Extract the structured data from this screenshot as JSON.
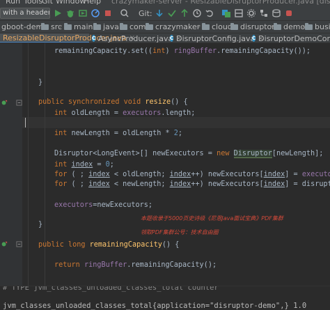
{
  "menubar": {
    "items": [
      "Run",
      "Tools",
      "Git",
      "Window",
      "Help"
    ],
    "title": "crazymaker-server - ResizableDisruptorProducer.java [disruptor-springboot-demo]"
  },
  "toolbar": {
    "run_config": "with a header#3",
    "git_label": "Git:"
  },
  "breadcrumb": [
    "gboot-demo",
    "src",
    "main",
    "java",
    "com",
    "crazymaker",
    "cloud",
    "disruptor",
    "demo",
    "business",
    "impl",
    "ResizableDisr"
  ],
  "tabs": [
    {
      "label": "ResizableDisruptorProducer.java",
      "active": true
    },
    {
      "label": "AsyncProducer.java",
      "active": false
    },
    {
      "label": "DisruptorConfig.java",
      "active": false
    },
    {
      "label": "DisruptorDemoControlle",
      "active": false
    }
  ],
  "code": {
    "l1": {
      "a": "remainingCapacity.set((",
      "b": "int",
      "c": ") ",
      "d": "ringBuffer",
      "e": ".remainingCapacity());"
    },
    "l2": "}",
    "l3": {
      "a": "public synchronized void ",
      "b": "resize",
      "c": "() {"
    },
    "l4": {
      "a": "int ",
      "b": "oldLength = ",
      "c": "executors",
      "d": ".length;"
    },
    "l5": {
      "a": "int ",
      "b": "newLength = oldLength * ",
      "c": "2",
      "d": ";"
    },
    "l6": {
      "a": "Disruptor<LongEvent>[] newExecutors = ",
      "b": "new ",
      "c": "Disruptor",
      "d": "[newLength];"
    },
    "l7": {
      "a": "int ",
      "b": "index",
      "c": " = ",
      "d": "0",
      "e": ";"
    },
    "l8": {
      "a": "for ",
      "b": "( ; ",
      "c": "index",
      "d": " < oldLength; ",
      "e": "index",
      "f": "++) newExecutors[",
      "g": "index",
      "h": "] = ",
      "i": "executors",
      "j": "[",
      "k": "index",
      "l": "];"
    },
    "l9": {
      "a": "for ",
      "b": "( ; ",
      "c": "index",
      "d": " < newLength; ",
      "e": "index",
      "f": "++) newExecutors[",
      "g": "index",
      "h": "] = disruptor();"
    },
    "l10": {
      "a": "executors",
      "b": "=newExecutors;"
    },
    "l11": "}",
    "l12": {
      "a": "public long ",
      "b": "remainingCapacity",
      "c": "() {"
    },
    "l13": {
      "a": "return ",
      "b": "ringBuffer",
      "c": ".remainingCapacity();"
    }
  },
  "watermark": {
    "line1": "本题收录于5000页史诗级《尼恩Java面试宝典》PDF集群",
    "line2": "领取PDF集群公号：技术自由圈"
  },
  "console": {
    "line1": "# TYPE jvm_classes_unloaded_classes_total counter",
    "line2": "jvm_classes_unloaded_classes_total{application=\"disruptor-demo\",} 1.0"
  },
  "colors": {
    "background": "#2b2b2b",
    "keyword": "#cc7832",
    "method": "#ffc66d",
    "field": "#9876aa",
    "number": "#6897bb"
  }
}
